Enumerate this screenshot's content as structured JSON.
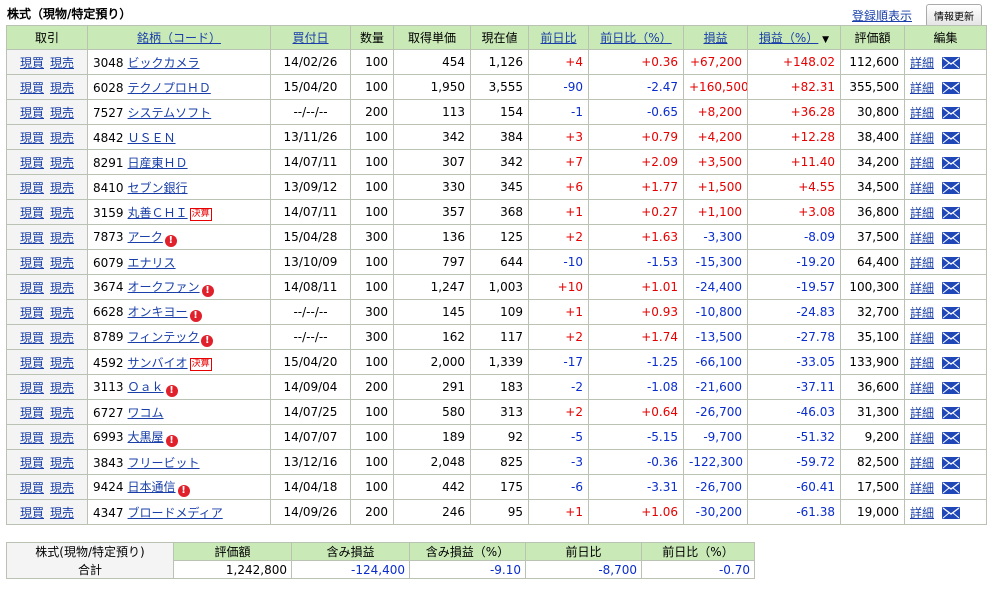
{
  "title": "株式（現物/特定預り）",
  "links": {
    "order_link": "登録順表示",
    "refresh_button": "情報更新"
  },
  "headers": {
    "trade": "取引",
    "name": "銘柄（コード）",
    "date": "買付日",
    "qty": "数量",
    "cost": "取得単価",
    "price": "現在値",
    "chg": "前日比",
    "chg_pct": "前日比（%）",
    "pl": "損益",
    "pl_pct": "損益（%）",
    "sort_mark": "▼",
    "value": "評価額",
    "edit": "編集"
  },
  "row_labels": {
    "buy": "現買",
    "sell": "現売",
    "detail": "詳細",
    "warn": "!",
    "kessan": "決算"
  },
  "rows": [
    {
      "code": "3048",
      "name": "ビックカメラ",
      "date": "14/02/26",
      "qty": "100",
      "cost": "454",
      "price": "1,126",
      "chg": "+4",
      "chg_pct": "+0.36",
      "pl": "+67,200",
      "pl_pct": "+148.02",
      "value": "112,600",
      "badge": ""
    },
    {
      "code": "6028",
      "name": "テクノプロＨＤ",
      "date": "15/04/20",
      "qty": "100",
      "cost": "1,950",
      "price": "3,555",
      "chg": "-90",
      "chg_pct": "-2.47",
      "pl": "+160,500",
      "pl_pct": "+82.31",
      "value": "355,500",
      "badge": ""
    },
    {
      "code": "7527",
      "name": "システムソフト",
      "date": "--/--/--",
      "qty": "200",
      "cost": "113",
      "price": "154",
      "chg": "-1",
      "chg_pct": "-0.65",
      "pl": "+8,200",
      "pl_pct": "+36.28",
      "value": "30,800",
      "badge": ""
    },
    {
      "code": "4842",
      "name": "ＵＳＥＮ",
      "date": "13/11/26",
      "qty": "100",
      "cost": "342",
      "price": "384",
      "chg": "+3",
      "chg_pct": "+0.79",
      "pl": "+4,200",
      "pl_pct": "+12.28",
      "value": "38,400",
      "badge": ""
    },
    {
      "code": "8291",
      "name": "日産東ＨＤ",
      "date": "14/07/11",
      "qty": "100",
      "cost": "307",
      "price": "342",
      "chg": "+7",
      "chg_pct": "+2.09",
      "pl": "+3,500",
      "pl_pct": "+11.40",
      "value": "34,200",
      "badge": ""
    },
    {
      "code": "8410",
      "name": "セブン銀行",
      "date": "13/09/12",
      "qty": "100",
      "cost": "330",
      "price": "345",
      "chg": "+6",
      "chg_pct": "+1.77",
      "pl": "+1,500",
      "pl_pct": "+4.55",
      "value": "34,500",
      "badge": ""
    },
    {
      "code": "3159",
      "name": "丸善ＣＨＩ",
      "date": "14/07/11",
      "qty": "100",
      "cost": "357",
      "price": "368",
      "chg": "+1",
      "chg_pct": "+0.27",
      "pl": "+1,100",
      "pl_pct": "+3.08",
      "value": "36,800",
      "badge": "kessan"
    },
    {
      "code": "7873",
      "name": "アーク",
      "date": "15/04/28",
      "qty": "300",
      "cost": "136",
      "price": "125",
      "chg": "+2",
      "chg_pct": "+1.63",
      "pl": "-3,300",
      "pl_pct": "-8.09",
      "value": "37,500",
      "badge": "warn"
    },
    {
      "code": "6079",
      "name": "エナリス",
      "date": "13/10/09",
      "qty": "100",
      "cost": "797",
      "price": "644",
      "chg": "-10",
      "chg_pct": "-1.53",
      "pl": "-15,300",
      "pl_pct": "-19.20",
      "value": "64,400",
      "badge": ""
    },
    {
      "code": "3674",
      "name": "オークファン",
      "date": "14/08/11",
      "qty": "100",
      "cost": "1,247",
      "price": "1,003",
      "chg": "+10",
      "chg_pct": "+1.01",
      "pl": "-24,400",
      "pl_pct": "-19.57",
      "value": "100,300",
      "badge": "warn"
    },
    {
      "code": "6628",
      "name": "オンキヨー",
      "date": "--/--/--",
      "qty": "300",
      "cost": "145",
      "price": "109",
      "chg": "+1",
      "chg_pct": "+0.93",
      "pl": "-10,800",
      "pl_pct": "-24.83",
      "value": "32,700",
      "badge": "warn"
    },
    {
      "code": "8789",
      "name": "フィンテック",
      "date": "--/--/--",
      "qty": "300",
      "cost": "162",
      "price": "117",
      "chg": "+2",
      "chg_pct": "+1.74",
      "pl": "-13,500",
      "pl_pct": "-27.78",
      "value": "35,100",
      "badge": "warn"
    },
    {
      "code": "4592",
      "name": "サンバイオ",
      "date": "15/04/20",
      "qty": "100",
      "cost": "2,000",
      "price": "1,339",
      "chg": "-17",
      "chg_pct": "-1.25",
      "pl": "-66,100",
      "pl_pct": "-33.05",
      "value": "133,900",
      "badge": "kessan"
    },
    {
      "code": "3113",
      "name": "Ｏａｋ",
      "date": "14/09/04",
      "qty": "200",
      "cost": "291",
      "price": "183",
      "chg": "-2",
      "chg_pct": "-1.08",
      "pl": "-21,600",
      "pl_pct": "-37.11",
      "value": "36,600",
      "badge": "warn"
    },
    {
      "code": "6727",
      "name": "ワコム",
      "date": "14/07/25",
      "qty": "100",
      "cost": "580",
      "price": "313",
      "chg": "+2",
      "chg_pct": "+0.64",
      "pl": "-26,700",
      "pl_pct": "-46.03",
      "value": "31,300",
      "badge": ""
    },
    {
      "code": "6993",
      "name": "大黒屋",
      "date": "14/07/07",
      "qty": "100",
      "cost": "189",
      "price": "92",
      "chg": "-5",
      "chg_pct": "-5.15",
      "pl": "-9,700",
      "pl_pct": "-51.32",
      "value": "9,200",
      "badge": "warn"
    },
    {
      "code": "3843",
      "name": "フリービット",
      "date": "13/12/16",
      "qty": "100",
      "cost": "2,048",
      "price": "825",
      "chg": "-3",
      "chg_pct": "-0.36",
      "pl": "-122,300",
      "pl_pct": "-59.72",
      "value": "82,500",
      "badge": ""
    },
    {
      "code": "9424",
      "name": "日本通信",
      "date": "14/04/18",
      "qty": "100",
      "cost": "442",
      "price": "175",
      "chg": "-6",
      "chg_pct": "-3.31",
      "pl": "-26,700",
      "pl_pct": "-60.41",
      "value": "17,500",
      "badge": "warn"
    },
    {
      "code": "4347",
      "name": "ブロードメディア",
      "date": "14/09/26",
      "qty": "200",
      "cost": "246",
      "price": "95",
      "chg": "+1",
      "chg_pct": "+1.06",
      "pl": "-30,200",
      "pl_pct": "-61.38",
      "value": "19,000",
      "badge": ""
    }
  ],
  "summary": {
    "label1": "株式(現物/特定預り)",
    "label2": "合計",
    "headers": [
      "評価額",
      "含み損益",
      "含み損益（%）",
      "前日比",
      "前日比（%）"
    ],
    "values": [
      "1,242,800",
      "-124,400",
      "-9.10",
      "-8,700",
      "-0.70"
    ]
  },
  "colors": {
    "header_bg": "#c9e9b7",
    "positive": "#e60000",
    "negative": "#0a2ccd",
    "link": "#1a3fa8"
  }
}
